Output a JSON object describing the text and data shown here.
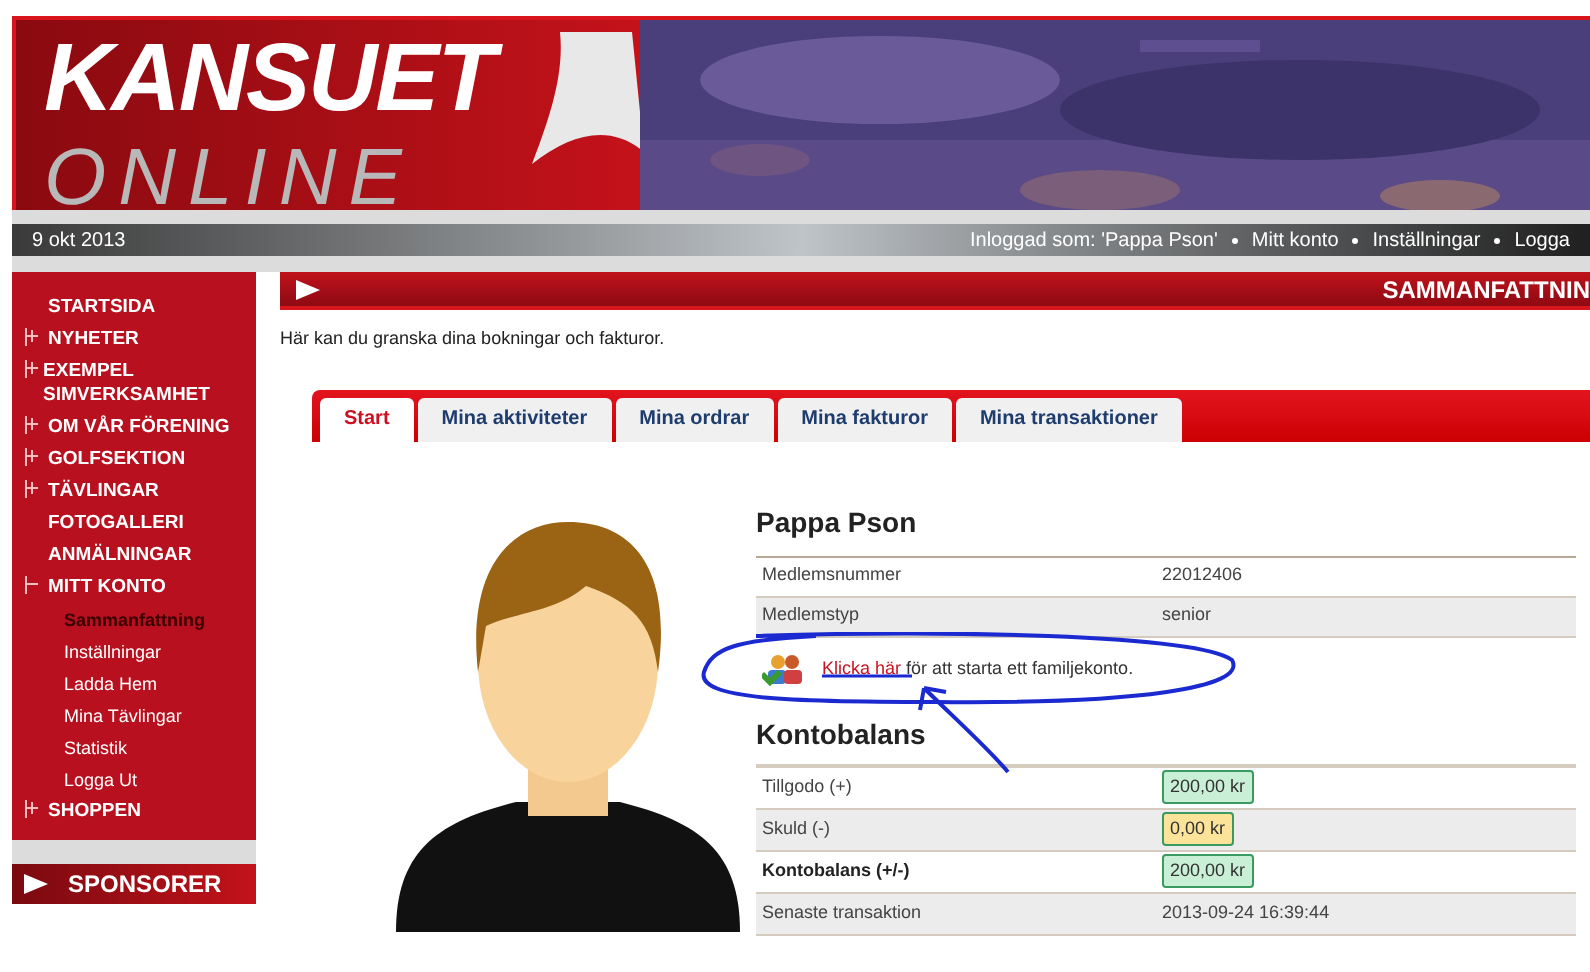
{
  "header": {
    "logo_top": "KANSUET",
    "logo_bottom": "ONLINE"
  },
  "top_bar": {
    "date": "9 okt 2013",
    "logged_in": "Inloggad som: 'Pappa Pson'",
    "links": [
      "Mitt konto",
      "Inställningar",
      "Logga"
    ]
  },
  "sidebar": {
    "items": [
      {
        "label": "STARTSIDA",
        "kind": "link"
      },
      {
        "label": "NYHETER",
        "kind": "expandable",
        "expanded": false
      },
      {
        "label": "EXEMPEL SIMVERKSAMHET",
        "kind": "expandable",
        "expanded": false
      },
      {
        "label": "OM VÅR FÖRENING",
        "kind": "expandable",
        "expanded": false
      },
      {
        "label": "GOLFSEKTION",
        "kind": "expandable",
        "expanded": false
      },
      {
        "label": "TÄVLINGAR",
        "kind": "expandable",
        "expanded": false
      },
      {
        "label": "FOTOGALLERI",
        "kind": "link"
      },
      {
        "label": "ANMÄLNINGAR",
        "kind": "link"
      },
      {
        "label": "MITT KONTO",
        "kind": "expandable",
        "expanded": true,
        "children": [
          {
            "label": "Sammanfattning",
            "selected": true
          },
          {
            "label": "Inställningar",
            "selected": false
          },
          {
            "label": "Ladda Hem",
            "selected": false
          },
          {
            "label": "Mina Tävlingar",
            "selected": false
          },
          {
            "label": "Statistik",
            "selected": false
          },
          {
            "label": "Logga Ut",
            "selected": false
          }
        ]
      },
      {
        "label": "SHOPPEN",
        "kind": "expandable",
        "expanded": false
      }
    ],
    "sponsors_title": "SPONSORER"
  },
  "page_title": "SAMMANFATTNIN",
  "intro": "Här kan du granska dina bokningar och fakturor.",
  "tabs": [
    {
      "label": "Start",
      "selected": true
    },
    {
      "label": "Mina aktiviteter",
      "selected": false
    },
    {
      "label": "Mina ordrar",
      "selected": false
    },
    {
      "label": "Mina fakturor",
      "selected": false
    },
    {
      "label": "Mina transaktioner",
      "selected": false
    }
  ],
  "profile": {
    "name": "Pappa Pson",
    "rows": [
      {
        "label": "Medlemsnummer",
        "value": "22012406"
      },
      {
        "label": "Medlemstyp",
        "value": "senior"
      }
    ],
    "family_link": "Klicka här",
    "family_text": "för att starta ett familjekonto."
  },
  "balance": {
    "title": "Kontobalans",
    "rows": [
      {
        "label": "Tillgodo (+)",
        "value": "200,00 kr",
        "kind": "badge",
        "color": "#c9f0d6",
        "bold": false
      },
      {
        "label": "Skuld (-)",
        "value": "0,00 kr",
        "kind": "badge",
        "color": "#fbe39a",
        "bold": false
      },
      {
        "label": "Kontobalans (+/-)",
        "value": "200,00 kr",
        "kind": "badge",
        "color": "#c9f0d6",
        "bold": true
      },
      {
        "label": "Senaste transaktion",
        "value": "2013-09-24 16:39:44",
        "kind": "text",
        "bold": false
      }
    ]
  }
}
